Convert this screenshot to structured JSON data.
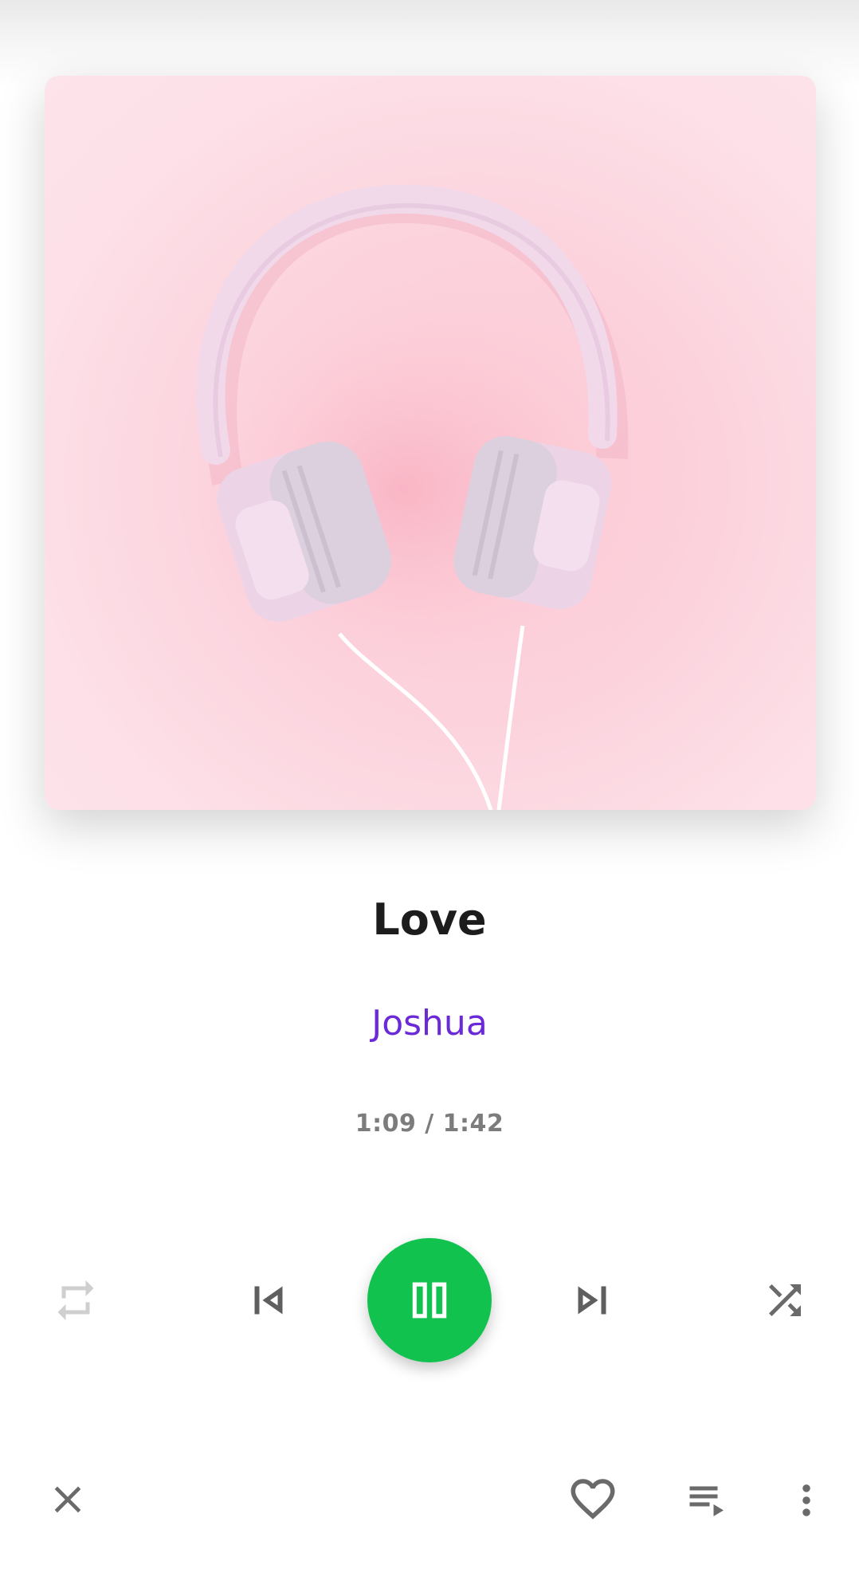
{
  "track": {
    "title": "Love",
    "artist": "Joshua",
    "time": "1:09 / 1:42"
  },
  "album_art": {
    "description_icon": "headphones-image"
  },
  "controls": {
    "repeat": {
      "icon": "repeat-icon",
      "state": "off"
    },
    "previous": {
      "icon": "skip-previous-icon"
    },
    "play_pause": {
      "icon": "pause-icon",
      "state": "playing"
    },
    "next": {
      "icon": "skip-next-icon"
    },
    "shuffle": {
      "icon": "shuffle-icon"
    }
  },
  "bottom_bar": {
    "close": {
      "icon": "close-icon"
    },
    "favorite": {
      "icon": "heart-outline-icon"
    },
    "queue": {
      "icon": "queue-icon"
    },
    "more": {
      "icon": "more-vertical-icon"
    }
  },
  "colors": {
    "accent_green": "#12c24f",
    "artist_purple": "#6a2ad8",
    "icon_gray": "#5f5f5f",
    "icon_disabled": "#cfcfcf"
  }
}
